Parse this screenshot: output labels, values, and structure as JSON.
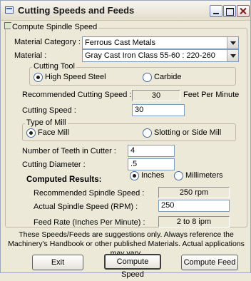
{
  "window": {
    "title": "Cutting Speeds and Feeds"
  },
  "frame": {
    "label": "Compute Spindle Speed"
  },
  "material_category": {
    "label": "Material  Category :",
    "value": "Ferrous Cast Metals"
  },
  "material": {
    "label": "Material :",
    "value": "Gray Cast Iron Class 55-60 : 220-260"
  },
  "cutting_tool": {
    "label": "Cutting Tool",
    "options": [
      {
        "label": "High Speed Steel",
        "selected": true
      },
      {
        "label": "Carbide",
        "selected": false
      }
    ]
  },
  "recommended_cutting_speed": {
    "label": "Recommended Cutting Speed :",
    "value": "30",
    "unit": "Feet Per Minute"
  },
  "cutting_speed": {
    "label": "Cutting Speed :",
    "value": "30"
  },
  "type_of_mill": {
    "label": "Type of Mill",
    "options": [
      {
        "label": "Face Mill",
        "selected": true
      },
      {
        "label": "Slotting or Side Mill",
        "selected": false
      }
    ]
  },
  "teeth": {
    "label": "Number of Teeth in Cutter :",
    "value": "4"
  },
  "diameter": {
    "label": "Cutting Diameter :",
    "value": ".5"
  },
  "units": {
    "options": [
      {
        "label": "Inches",
        "selected": true
      },
      {
        "label": "Millimeters",
        "selected": false
      }
    ]
  },
  "results": {
    "heading": "Computed Results:",
    "recommended_spindle_label": "Recommended Spindle Speed :",
    "recommended_spindle_value": "250 rpm",
    "actual_spindle_label": "Actual Spindle Speed (RPM) :",
    "actual_spindle_value": "250",
    "feed_rate_label": "Feed Rate (Inches Per Minute) :",
    "feed_rate_value": "2 to 8 ipm"
  },
  "note": "These Speeds/Feeds are suggestions only.  Always reference the Machinery's Handbook or other published Materials.  Actual applications may vary.",
  "buttons": {
    "exit": "Exit",
    "compute_speed": "Compute Speed",
    "compute_feed": "Compute Feed"
  }
}
